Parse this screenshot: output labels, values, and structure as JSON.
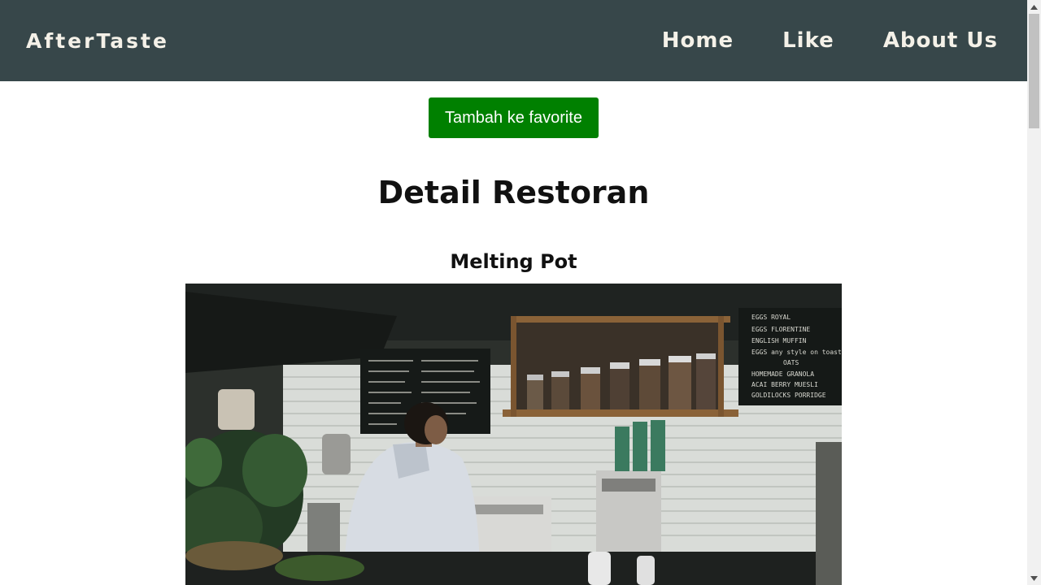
{
  "header": {
    "brand": "AfterTaste",
    "nav": [
      {
        "label": "Home"
      },
      {
        "label": "Like"
      },
      {
        "label": "About Us"
      }
    ]
  },
  "actions": {
    "favorite_label": "Tambah ke favorite"
  },
  "main": {
    "title": "Detail Restoran",
    "restaurant_name": "Melting Pot"
  },
  "photo_menu_board": {
    "right_board_lines": [
      "EGGS ROYAL",
      "EGGS FLORENTINE",
      "ENGLISH MUFFIN",
      "EGGS any style on toast",
      "OATS",
      "HOMEMADE GRANOLA",
      "ACAI BERRY MUESLI",
      "GOLDILOCKS PORRIDGE"
    ]
  },
  "colors": {
    "navbar": "#37474a",
    "nav_text": "#f4f1e8",
    "favorite_button": "#008000"
  }
}
